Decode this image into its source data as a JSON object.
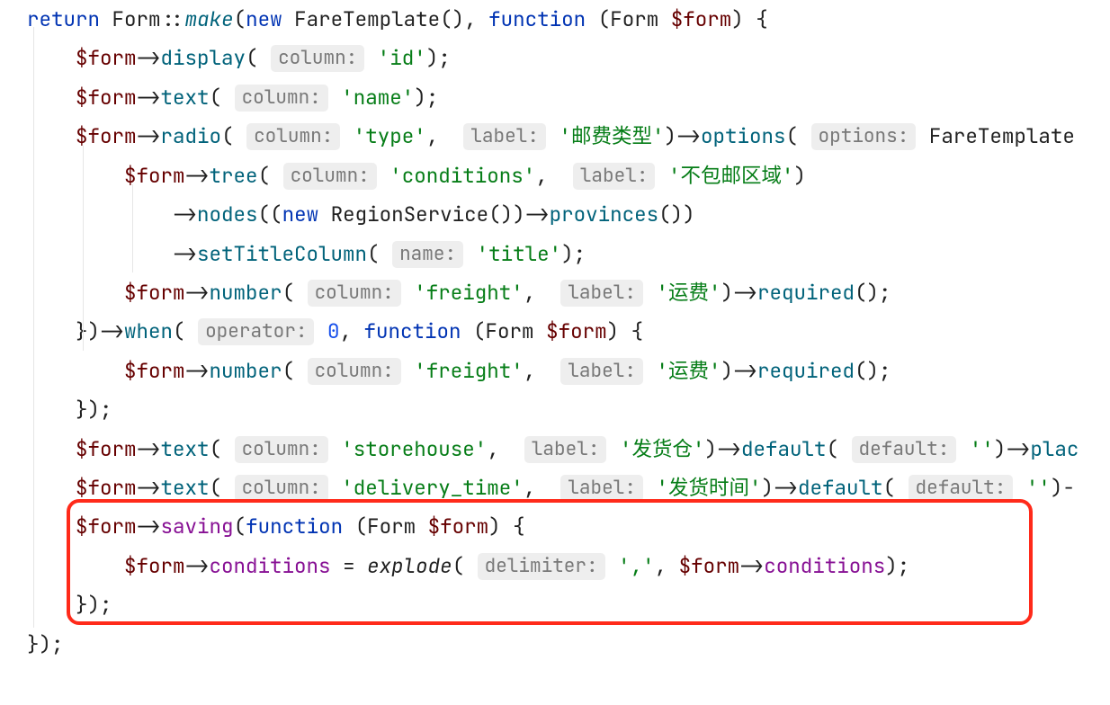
{
  "hints": {
    "column": "column:",
    "label": "label:",
    "options": "options:",
    "name": "name:",
    "operator": "operator:",
    "default": "default:",
    "delimiter": "delimiter:"
  },
  "tok": {
    "return": "return",
    "new": "new",
    "function": "function",
    "Form": "Form",
    "FareTemplate": "FareTemplate",
    "RegionService": "RegionService",
    "make": "make",
    "formVar": "$form",
    "display": "display",
    "text": "text",
    "radio": "radio",
    "tree": "tree",
    "nodes": "nodes",
    "provinces": "provinces",
    "setTitleColumn": "setTitleColumn",
    "number": "number",
    "required": "required",
    "when": "when",
    "default_m": "default",
    "plac": "plac",
    "options_m": "options",
    "saving": "saving",
    "explode": "explode",
    "conditions": "conditions",
    "zero": "0"
  },
  "str": {
    "id": "'id'",
    "name": "'name'",
    "type": "'type'",
    "postage_type": "'邮费类型'",
    "conditions": "'conditions'",
    "no_ship_region": "'不包邮区域'",
    "title": "'title'",
    "freight": "'freight'",
    "freight_cn": "'运费'",
    "storehouse": "'storehouse'",
    "storehouse_cn": "'发货仓'",
    "empty": "''",
    "delivery_time": "'delivery_time'",
    "delivery_time_cn": "'发货时间'",
    "comma": "','"
  }
}
